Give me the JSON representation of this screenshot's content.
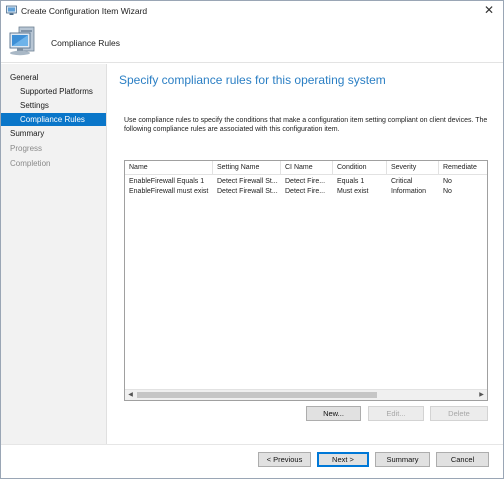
{
  "window": {
    "title": "Create Configuration Item Wizard",
    "close_glyph": "✕"
  },
  "header": {
    "page_name": "Compliance Rules",
    "icon": "computer-monitor-icon"
  },
  "nav": {
    "items": [
      {
        "label": "General",
        "state": "normal"
      },
      {
        "label": "Supported Platforms",
        "state": "normal"
      },
      {
        "label": "Settings",
        "state": "normal"
      },
      {
        "label": "Compliance Rules",
        "state": "selected"
      },
      {
        "label": "Summary",
        "state": "normal"
      },
      {
        "label": "Progress",
        "state": "disabled"
      },
      {
        "label": "Completion",
        "state": "disabled"
      }
    ]
  },
  "content": {
    "heading": "Specify compliance rules for this operating system",
    "description": "Use compliance rules to specify the conditions that make a configuration item setting compliant on client devices. The following compliance rules are associated with this configuration item."
  },
  "table": {
    "columns": [
      "Name",
      "Setting Name",
      "CI Name",
      "Condition",
      "Severity",
      "Remediate"
    ],
    "rows": [
      [
        "EnableFirewall Equals 1",
        "Detect Firewall St...",
        "Detect Fire...",
        "Equals 1",
        "Critical",
        "No"
      ],
      [
        "EnableFirewall must exist",
        "Detect Firewall St...",
        "Detect Fire...",
        "Must exist",
        "Information",
        "No"
      ]
    ]
  },
  "table_buttons": {
    "new": "New...",
    "edit": "Edit...",
    "delete": "Delete"
  },
  "footer_buttons": {
    "previous": "< Previous",
    "next": "Next >",
    "summary": "Summary",
    "cancel": "Cancel"
  },
  "colors": {
    "accent": "#0a76c9",
    "heading": "#2b7fc4"
  }
}
